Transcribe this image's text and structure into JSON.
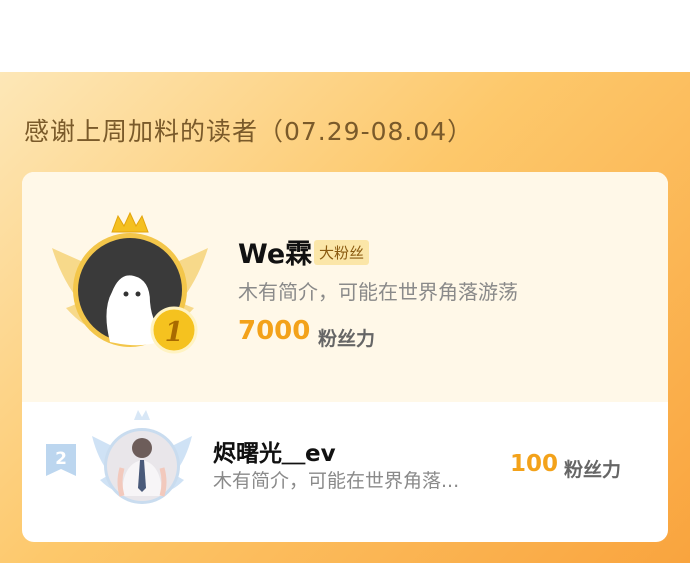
{
  "panel": {
    "title": "感谢上周加料的读者（07.29-08.04）"
  },
  "first": {
    "rank": "1",
    "name": "We霖",
    "tag": "大粉丝",
    "bio": "木有简介，可能在世界角落游荡",
    "score": "7000",
    "unit": "粉丝力",
    "icons": [
      "crown-icon",
      "wings-icon",
      "default-avatar-icon",
      "gold-medal-icon"
    ]
  },
  "second": {
    "rank": "2",
    "name": "烬曙光＿ev",
    "bio": "木有简介，可能在世界角落...",
    "score": "100",
    "unit": "粉丝力",
    "icons": [
      "rank-ribbon-icon",
      "wings-icon",
      "avatar-photo"
    ]
  },
  "colors": {
    "panel_gradient": [
      "#fde7b7",
      "#f9a43e"
    ],
    "accent": "#f3a21a",
    "gold": "#f5c21f",
    "rank2_badge": "#bcd6ef"
  }
}
